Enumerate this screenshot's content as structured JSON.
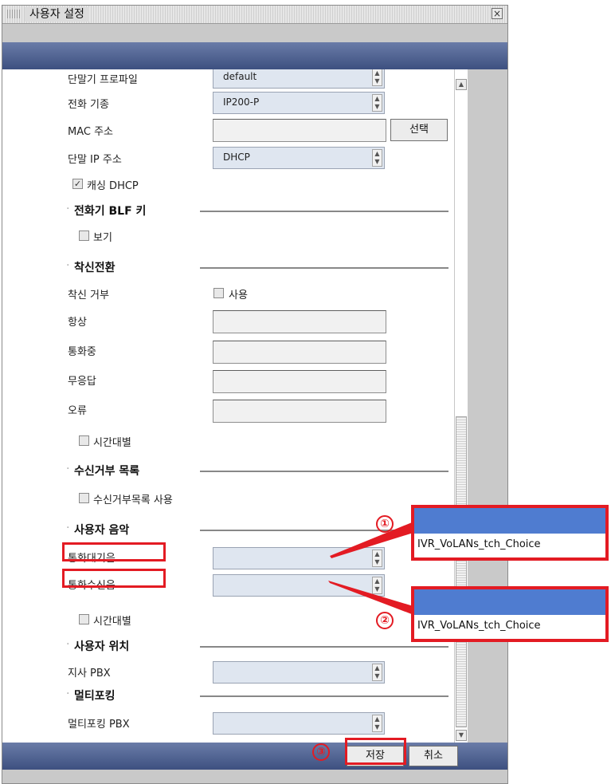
{
  "window": {
    "title": "사용자 설정",
    "close_glyph": "×"
  },
  "fields": {
    "profile": {
      "label": "단말기 프로파일",
      "value": "default"
    },
    "phone_model": {
      "label": "전화 기종",
      "value": "IP200-P"
    },
    "mac": {
      "label": "MAC 주소",
      "value": "",
      "button": "선택"
    },
    "ip": {
      "label": "단말 IP 주소",
      "value": "DHCP"
    },
    "caching_dhcp": {
      "label": "캐싱 DHCP",
      "checked": true
    }
  },
  "sections": {
    "blf": {
      "title": "전화기 BLF 키",
      "view_label": "보기"
    },
    "forward": {
      "title": "착신전환",
      "reject_label": "착신 거부",
      "use_label": "사용",
      "always": "항상",
      "busy": "통화중",
      "no_answer": "무응답",
      "error": "오류",
      "by_time": "시간대별"
    },
    "block": {
      "title": "수신거부 목록",
      "use_label": "수신거부목록 사용"
    },
    "music": {
      "title": "사용자 음악",
      "hold_label": "통화대기음",
      "ring_label": "통화수신음",
      "by_time": "시간대별"
    },
    "location": {
      "title": "사용자 위치",
      "branch_label": "지사 PBX"
    },
    "multiforking": {
      "title": "멀티포킹",
      "pbx_label": "멀티포킹 PBX"
    }
  },
  "footer": {
    "save": "저장",
    "cancel": "취소"
  },
  "callouts": {
    "one": "①",
    "two": "②",
    "three": "③",
    "popup1_text": "IVR_VoLANs_tch_Choice",
    "popup2_text": "IVR_VoLANs_tch_Choice"
  },
  "colors": {
    "highlight": "#e31b23",
    "popup_header": "#4f7cd0",
    "header_bar": "#4a5d8c"
  }
}
